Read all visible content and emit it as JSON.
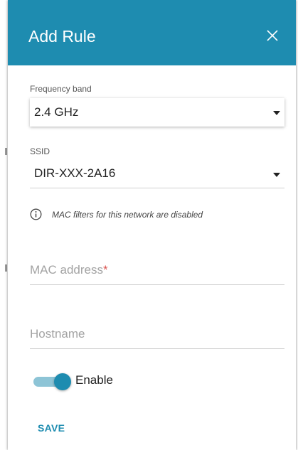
{
  "dialog": {
    "title": "Add Rule",
    "close_icon": "close-icon",
    "accent_color": "#1e8cb0"
  },
  "frequency_band": {
    "label": "Frequency band",
    "value": "2.4 GHz"
  },
  "ssid": {
    "label": "SSID",
    "value": "DIR-XXX-2A16"
  },
  "info": {
    "icon": "info-icon",
    "text": "MAC filters for this network are disabled"
  },
  "mac_address": {
    "placeholder": "MAC address",
    "required_mark": "*"
  },
  "hostname": {
    "placeholder": "Hostname"
  },
  "enable_toggle": {
    "label": "Enable",
    "checked": true
  },
  "save_button": {
    "label": "SAVE"
  }
}
